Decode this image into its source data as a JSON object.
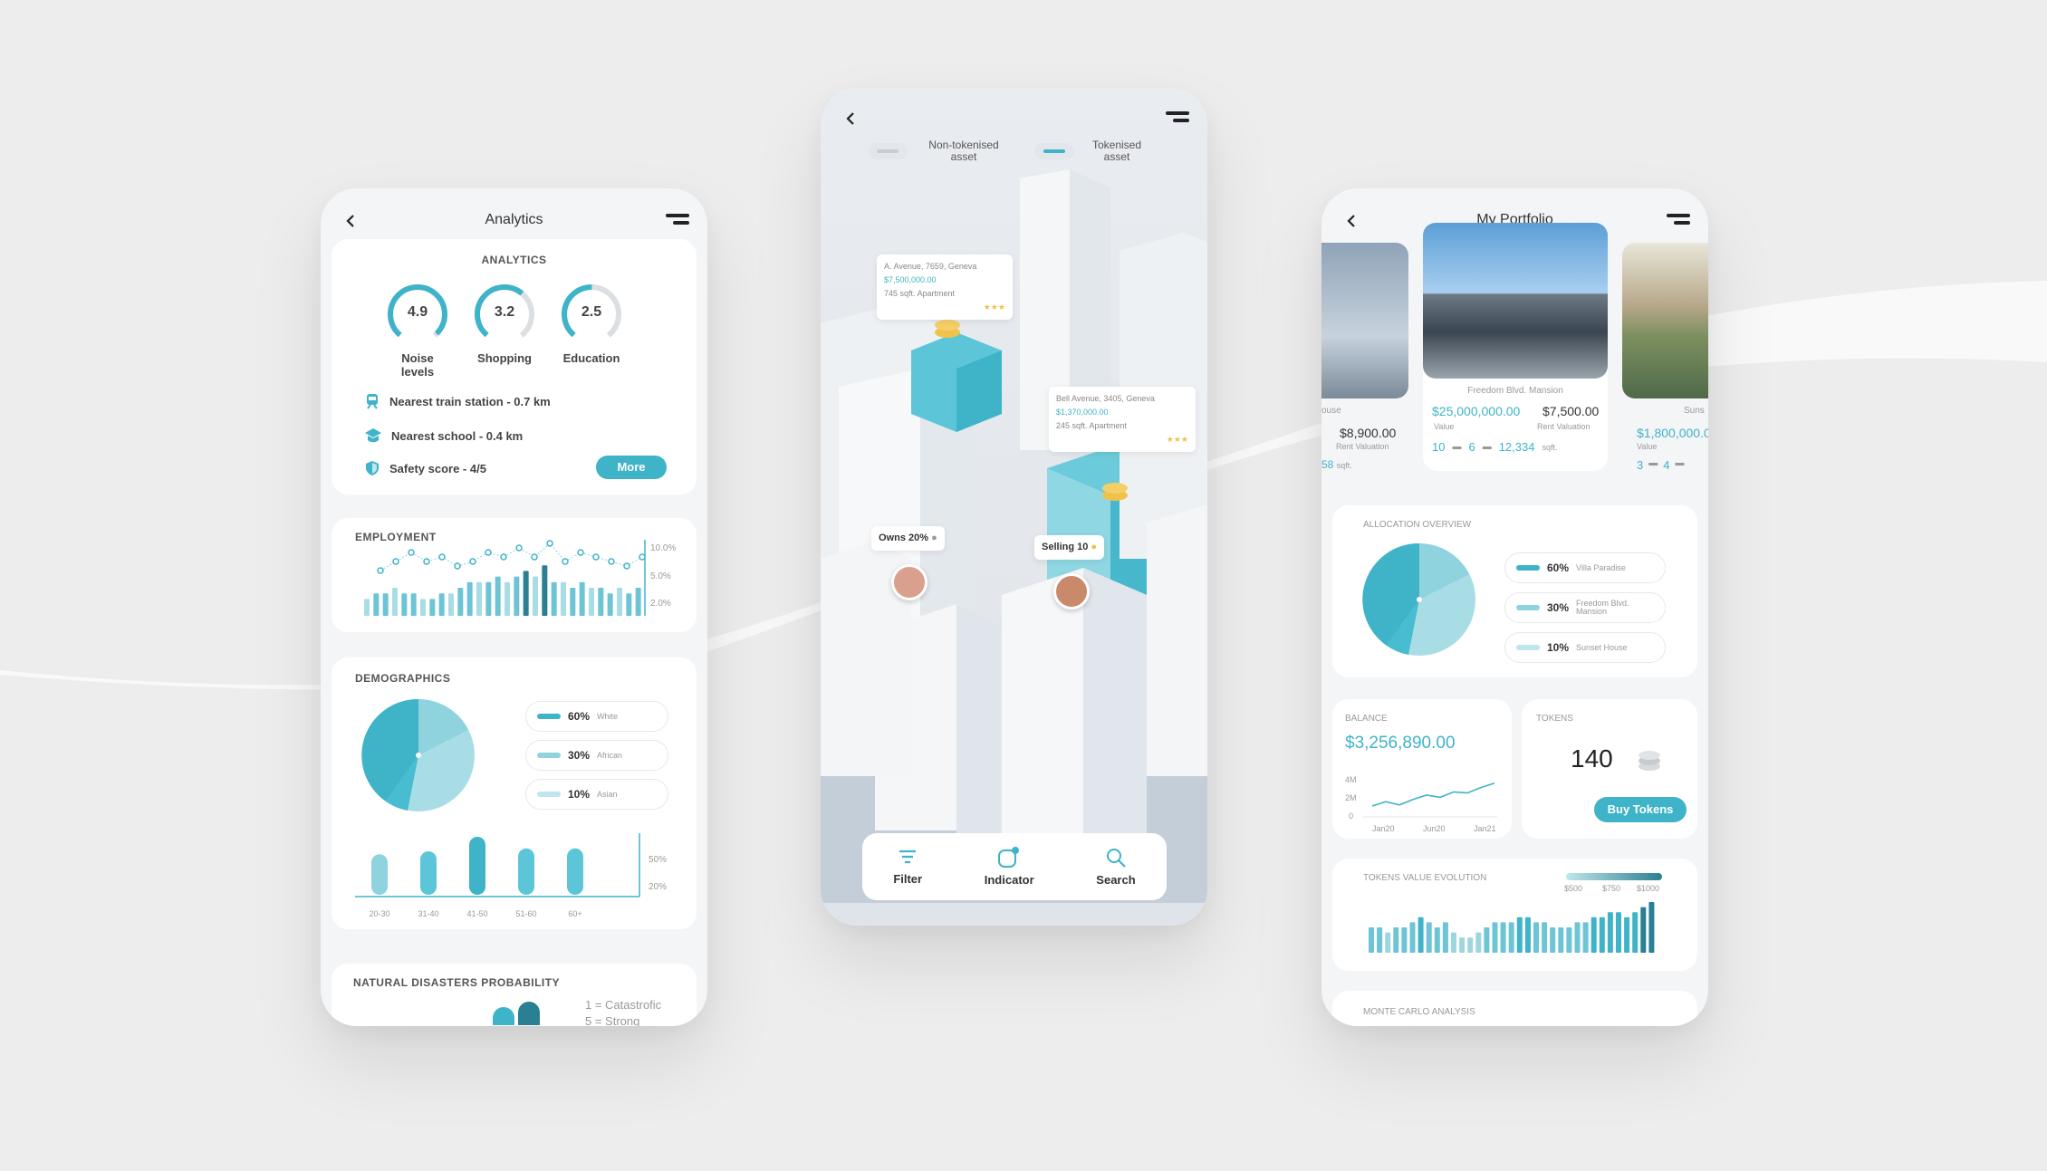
{
  "colors": {
    "accent": "#3fb3c8",
    "accent_light": "#8fd3de",
    "accent_pale": "#bfe6ec",
    "dark_teal": "#2a7f93"
  },
  "left": {
    "title": "Analytics",
    "analytics": {
      "heading": "ANALYTICS",
      "gauges": [
        {
          "value": "4.9",
          "label": "Noise levels",
          "fill": 0.98
        },
        {
          "value": "3.2",
          "label": "Shopping",
          "fill": 0.64
        },
        {
          "value": "2.5",
          "label": "Education",
          "fill": 0.5
        }
      ],
      "info": [
        {
          "icon": "train-icon",
          "text": "Nearest train station - 0.7 km"
        },
        {
          "icon": "school-icon",
          "text": "Nearest school - 0.4 km"
        },
        {
          "icon": "shield-icon",
          "text": "Safety score - 4/5"
        }
      ],
      "more_label": "More"
    },
    "employment": {
      "heading": "EMPLOYMENT",
      "y_ticks": [
        "10.0%",
        "5.0%",
        "2.0%"
      ],
      "bars": [
        3,
        4,
        4,
        5,
        4,
        4,
        3,
        3,
        4,
        4,
        5,
        6,
        6,
        6,
        7,
        6,
        7,
        8,
        7,
        9,
        6,
        6,
        5,
        6,
        5,
        5,
        4,
        5,
        4,
        5
      ],
      "points": [
        4,
        6,
        8,
        6,
        7,
        5,
        6,
        8,
        7,
        9,
        7,
        10,
        6,
        8,
        7,
        6,
        5,
        7
      ]
    },
    "demographics": {
      "heading": "DEMOGRAPHICS",
      "legend": [
        {
          "pct": "60%",
          "name": "White",
          "value": 60
        },
        {
          "pct": "30%",
          "name": "African",
          "value": 30
        },
        {
          "pct": "10%",
          "name": "Asian",
          "value": 10
        }
      ],
      "age_groups": [
        "20-30",
        "31-40",
        "41-50",
        "51-60",
        "60+"
      ],
      "age_values": [
        28,
        30,
        40,
        32,
        32
      ],
      "y_ticks": [
        "50%",
        "20%"
      ]
    },
    "disasters": {
      "heading": "NATURAL DISASTERS PROBABILITY",
      "legend": [
        "1 = Catastrofic",
        "5 = Strong"
      ]
    }
  },
  "mid": {
    "toggle_left": "Non-tokenised asset",
    "toggle_right": "Tokenised asset",
    "tag1": {
      "address": "A. Avenue, 7659, Geneva",
      "price": "$7,500,000.00",
      "desc": "745 sqft. Apartment",
      "stars": "★★★"
    },
    "tag2": {
      "address": "Bell Avenue, 3405, Geneva",
      "price": "$1,370,000.00",
      "desc": "245 sqft. Apartment",
      "stars": "★★★"
    },
    "owns": "Owns 20%",
    "selling": "Selling 10",
    "nav": [
      {
        "label": "Filter",
        "icon": "filter-icon"
      },
      {
        "label": "Indicator",
        "icon": "indicator-icon"
      },
      {
        "label": "Search",
        "icon": "search-icon"
      }
    ]
  },
  "right": {
    "title": "My Portfolio",
    "left_prop": {
      "name": "ouse",
      "value": "$8,900.00",
      "rent_label": "Rent Valuation",
      "sqft": "58"
    },
    "main_prop": {
      "name": "Freedom Blvd. Mansion",
      "value": "$25,000,000.00",
      "value_label": "Value",
      "rent": "$7,500.00",
      "rent_label": "Rent Valuation",
      "beds": "10",
      "baths": "6",
      "area": "12,334",
      "area_unit": "sqft."
    },
    "right_prop": {
      "name": "Suns",
      "value": "$1,800,000.0",
      "value_label": "Value",
      "beds": "3",
      "baths": "4"
    },
    "allocation": {
      "heading": "ALLOCATION OVERVIEW",
      "legend": [
        {
          "pct": "60%",
          "name": "Villa Paradise",
          "value": 60
        },
        {
          "pct": "30%",
          "name": "Freedom Blvd. Mansion",
          "value": 30
        },
        {
          "pct": "10%",
          "name": "Sunset House",
          "value": 10
        }
      ]
    },
    "balance": {
      "heading": "BALANCE",
      "amount": "$3,256,890.00",
      "y_ticks": [
        "4M",
        "2M",
        "0"
      ],
      "x_ticks": [
        "Jan20",
        "Jun20",
        "Jan21"
      ],
      "series": [
        1.0,
        1.4,
        1.1,
        1.6,
        2.0,
        1.8,
        2.3,
        2.2,
        2.7,
        3.1
      ]
    },
    "tokens": {
      "heading": "TOKENS",
      "count": "140",
      "buy_label": "Buy Tokens"
    },
    "evolution": {
      "heading": "TOKENS VALUE EVOLUTION",
      "scale": [
        "$500",
        "$750",
        "$1000"
      ],
      "bars": [
        5,
        5,
        4,
        5,
        5,
        6,
        7,
        6,
        5,
        6,
        4,
        3,
        3,
        4,
        5,
        6,
        6,
        6,
        7,
        7,
        6,
        6,
        5,
        5,
        5,
        6,
        6,
        7,
        7,
        8,
        8,
        7,
        8,
        9,
        10
      ]
    },
    "monte": {
      "heading": "MONTE CARLO ANALYSIS"
    }
  }
}
